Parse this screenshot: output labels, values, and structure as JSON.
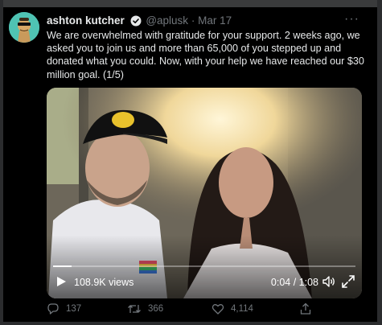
{
  "tweet": {
    "author_name": "ashton kutcher",
    "handle": "@aplusk",
    "separator": "·",
    "date": "Mar 17",
    "more": "···",
    "text": "We are overwhelmed with gratitude for your support. 2 weeks ago, we asked you to join us and more than 65,000 of you stepped up and donated what you could. Now, with your help we have reached our $30 million goal. (1/5)",
    "verified": true
  },
  "video": {
    "views": "108.9K views",
    "time": "0:04 / 1:08",
    "progress": 0.06
  },
  "actions": {
    "replies": "137",
    "retweets": "366",
    "likes": "4,114"
  },
  "colors": {
    "background": "#000000",
    "text": "#e7e9ea",
    "muted": "#71767b",
    "verified": "#1d9bf0",
    "avatar_bg": "#4fc3b3"
  },
  "icons": [
    "verified-badge-icon",
    "more-icon",
    "play-icon",
    "volume-icon",
    "fullscreen-icon",
    "reply-icon",
    "retweet-icon",
    "like-icon",
    "share-icon"
  ]
}
